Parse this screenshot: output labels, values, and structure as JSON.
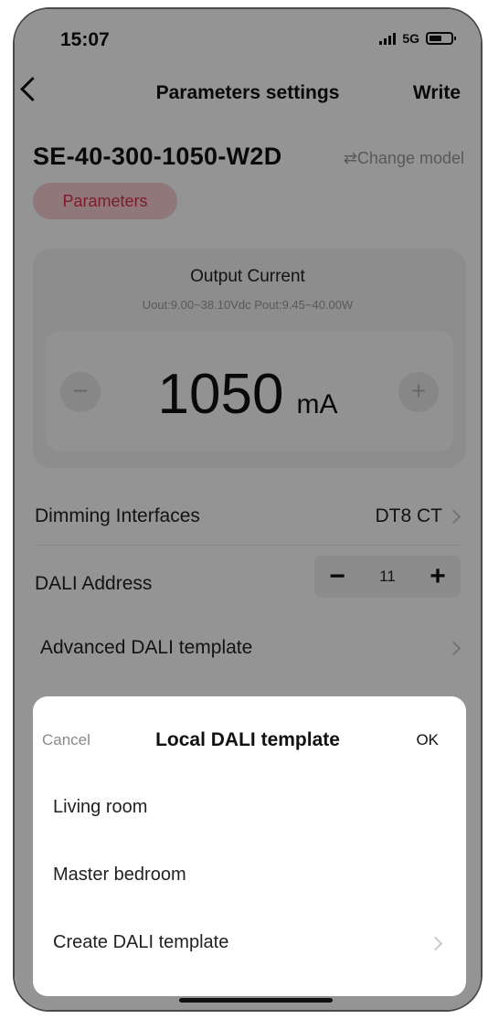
{
  "status_bar": {
    "time": "15:07",
    "network": "5G",
    "icons": [
      "signal-icon",
      "battery-icon"
    ]
  },
  "nav": {
    "back_icon": "chevron-left-icon",
    "title": "Parameters settings",
    "write_label": "Write"
  },
  "device": {
    "model": "SE-40-300-1050-W2D",
    "change_model": "⇄Change model"
  },
  "tabs": [
    {
      "label": "Parameters",
      "active": true
    }
  ],
  "output_current": {
    "title": "Output Current",
    "range": "Uout:9.00~38.10Vdc   Pout:9.45~40.00W",
    "value": "1050",
    "unit": "mA",
    "minus_label": "−",
    "plus_label": "+"
  },
  "settings": {
    "dimming_label": "Dimming Interfaces",
    "dimming_value": "DT8 CT",
    "dali_label": "DALI Address",
    "dali_minus": "−",
    "dali_value": "11",
    "dali_plus": "+",
    "advanced_label": "Advanced DALI template"
  },
  "sheet": {
    "cancel_label": "Cancel",
    "title": "Local DALI template",
    "ok_label": "OK",
    "options": [
      "Living room",
      "Master bedroom",
      "Create DALI template"
    ]
  },
  "colors": {
    "accent": "#d8324a",
    "accent_bg": "#f6cdd2",
    "overlay": "rgba(0,0,0,0.42)"
  }
}
